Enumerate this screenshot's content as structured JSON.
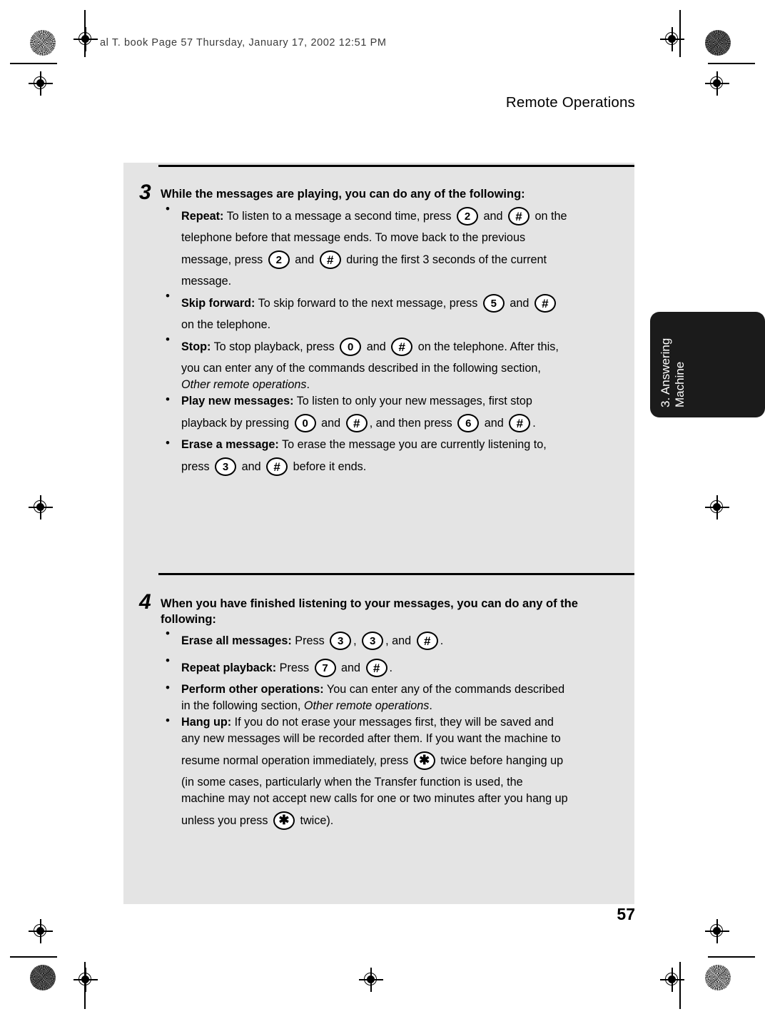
{
  "page": {
    "filename_line": "al T. book  Page 57  Thursday, January 17, 2002  12:51 PM",
    "running_head": "Remote Operations",
    "page_number": "57",
    "side_tab_label": "3. Answering Machine",
    "panel_color": "#e4e4e4",
    "tab_color": "#1b1b1b"
  },
  "steps": [
    {
      "number": "3",
      "title": "While the messages are playing, you can do any of the following:",
      "bullets": [
        {
          "lead": "Repeat:",
          "lines": [
            [
              {
                "t": "text",
                "v": " To listen to a message a second time, press "
              },
              {
                "t": "key",
                "v": "2"
              },
              {
                "t": "text",
                "v": " and "
              },
              {
                "t": "key",
                "v": "#"
              },
              {
                "t": "text",
                "v": " on the"
              }
            ],
            [
              {
                "t": "text",
                "v": "telephone before that message ends. To move back to the previous"
              }
            ],
            [
              {
                "t": "text",
                "v": "message, press "
              },
              {
                "t": "key",
                "v": "2"
              },
              {
                "t": "text",
                "v": " and "
              },
              {
                "t": "key",
                "v": "#"
              },
              {
                "t": "text",
                "v": " during the first 3 seconds of the current"
              }
            ],
            [
              {
                "t": "text",
                "v": "message."
              }
            ]
          ]
        },
        {
          "lead": "Skip forward:",
          "lines": [
            [
              {
                "t": "text",
                "v": " To skip forward to the next message, press "
              },
              {
                "t": "key",
                "v": "5"
              },
              {
                "t": "text",
                "v": " and "
              },
              {
                "t": "key",
                "v": "#"
              }
            ],
            [
              {
                "t": "text",
                "v": "on the telephone."
              }
            ]
          ]
        },
        {
          "lead": "Stop:",
          "lines": [
            [
              {
                "t": "text",
                "v": " To stop playback, press "
              },
              {
                "t": "key",
                "v": "0"
              },
              {
                "t": "text",
                "v": " and "
              },
              {
                "t": "key",
                "v": "#"
              },
              {
                "t": "text",
                "v": " on the telephone. After this,"
              }
            ],
            [
              {
                "t": "text",
                "v": "you can enter any of the commands described in the following section,"
              }
            ],
            [
              {
                "t": "italic",
                "v": "Other remote operations"
              },
              {
                "t": "text",
                "v": "."
              }
            ]
          ]
        },
        {
          "lead": "Play new messages:",
          "lines": [
            [
              {
                "t": "text",
                "v": " To listen to only your new messages, first stop"
              }
            ],
            [
              {
                "t": "text",
                "v": "playback by pressing "
              },
              {
                "t": "key",
                "v": "0"
              },
              {
                "t": "text",
                "v": " and "
              },
              {
                "t": "key",
                "v": "#"
              },
              {
                "t": "text",
                "v": ", and then press "
              },
              {
                "t": "key",
                "v": "6"
              },
              {
                "t": "text",
                "v": " and "
              },
              {
                "t": "key",
                "v": "#"
              },
              {
                "t": "text",
                "v": "."
              }
            ]
          ]
        },
        {
          "lead": "Erase a message:",
          "lines": [
            [
              {
                "t": "text",
                "v": " To erase the message you are currently listening to,"
              }
            ],
            [
              {
                "t": "text",
                "v": "press "
              },
              {
                "t": "key",
                "v": "3"
              },
              {
                "t": "text",
                "v": " and "
              },
              {
                "t": "key",
                "v": "#"
              },
              {
                "t": "text",
                "v": " before it ends."
              }
            ]
          ]
        }
      ]
    },
    {
      "number": "4",
      "title": "When you have finished listening to your messages, you can do any of the following:",
      "bullets": [
        {
          "lead": "Erase all messages:",
          "lines": [
            [
              {
                "t": "text",
                "v": " Press "
              },
              {
                "t": "key",
                "v": "3"
              },
              {
                "t": "text",
                "v": ", "
              },
              {
                "t": "key",
                "v": "3"
              },
              {
                "t": "text",
                "v": ", and "
              },
              {
                "t": "key",
                "v": "#"
              },
              {
                "t": "text",
                "v": "."
              }
            ]
          ]
        },
        {
          "lead": "Repeat playback:",
          "lines": [
            [
              {
                "t": "text",
                "v": " Press "
              },
              {
                "t": "key",
                "v": "7"
              },
              {
                "t": "text",
                "v": " and "
              },
              {
                "t": "key",
                "v": "#"
              },
              {
                "t": "text",
                "v": "."
              }
            ]
          ]
        },
        {
          "lead": "Perform other operations:",
          "lines": [
            [
              {
                "t": "text",
                "v": " You can enter any of the commands described"
              }
            ],
            [
              {
                "t": "text",
                "v": "in the following section, "
              },
              {
                "t": "italic",
                "v": "Other remote operations"
              },
              {
                "t": "text",
                "v": "."
              }
            ]
          ]
        },
        {
          "lead": "Hang up:",
          "lines": [
            [
              {
                "t": "text",
                "v": " If you do not erase your messages first, they will be saved and"
              }
            ],
            [
              {
                "t": "text",
                "v": "any new messages will be recorded after them. If you want the machine to"
              }
            ],
            [
              {
                "t": "text",
                "v": "resume normal operation immediately, press "
              },
              {
                "t": "key",
                "v": "*"
              },
              {
                "t": "text",
                "v": " twice before hanging up"
              }
            ],
            [
              {
                "t": "text",
                "v": "(in some cases, particularly when the Transfer function is used, the"
              }
            ],
            [
              {
                "t": "text",
                "v": "machine may not accept new calls for one or two minutes after you hang up"
              }
            ],
            [
              {
                "t": "text",
                "v": "unless you press "
              },
              {
                "t": "key",
                "v": "*"
              },
              {
                "t": "text",
                "v": " twice)."
              }
            ]
          ]
        }
      ]
    }
  ]
}
